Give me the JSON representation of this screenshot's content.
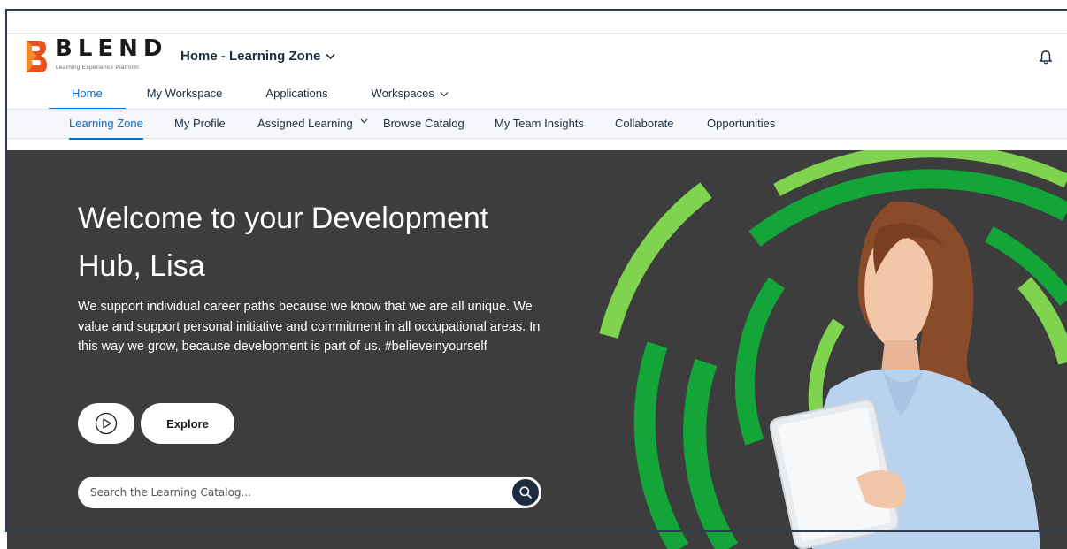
{
  "brand": {
    "name": "BLEND",
    "tagline": "Learning Experience Platform",
    "accent": "#e8501e"
  },
  "header": {
    "app_title": "Home - Learning Zone",
    "notification_icon": "bell-icon"
  },
  "primary_nav": {
    "items": [
      {
        "label": "Home",
        "active": true
      },
      {
        "label": "My Workspace",
        "active": false
      },
      {
        "label": "Applications",
        "active": false
      },
      {
        "label": "Workspaces",
        "active": false,
        "has_dropdown": true
      }
    ]
  },
  "sub_nav": {
    "items": [
      {
        "label": "Learning Zone",
        "active": true
      },
      {
        "label": "My Profile",
        "active": false
      },
      {
        "label": "Assigned Learning",
        "active": false,
        "has_dropdown": true
      },
      {
        "label": "Browse Catalog",
        "active": false
      },
      {
        "label": "My Team Insights",
        "active": false
      },
      {
        "label": "Collaborate",
        "active": false
      },
      {
        "label": "Opportunities",
        "active": false
      }
    ]
  },
  "hero": {
    "title": "Welcome to your Development Hub, Lisa",
    "description": "We support individual career paths because we know that we are all unique. We value and support personal initiative and commitment in all occupational areas. In this way we grow, because development is part of us. #believeinyourself",
    "explore_label": "Explore",
    "play_icon": "play-icon",
    "search_placeholder": "Search the Learning Catalog...",
    "search_icon": "search-icon",
    "background": "#3d3d3d",
    "ring_colors": [
      "#13a538",
      "#7fd34e"
    ]
  },
  "colors": {
    "link_active": "#0a6ed1",
    "text": "#1d2d3e"
  }
}
